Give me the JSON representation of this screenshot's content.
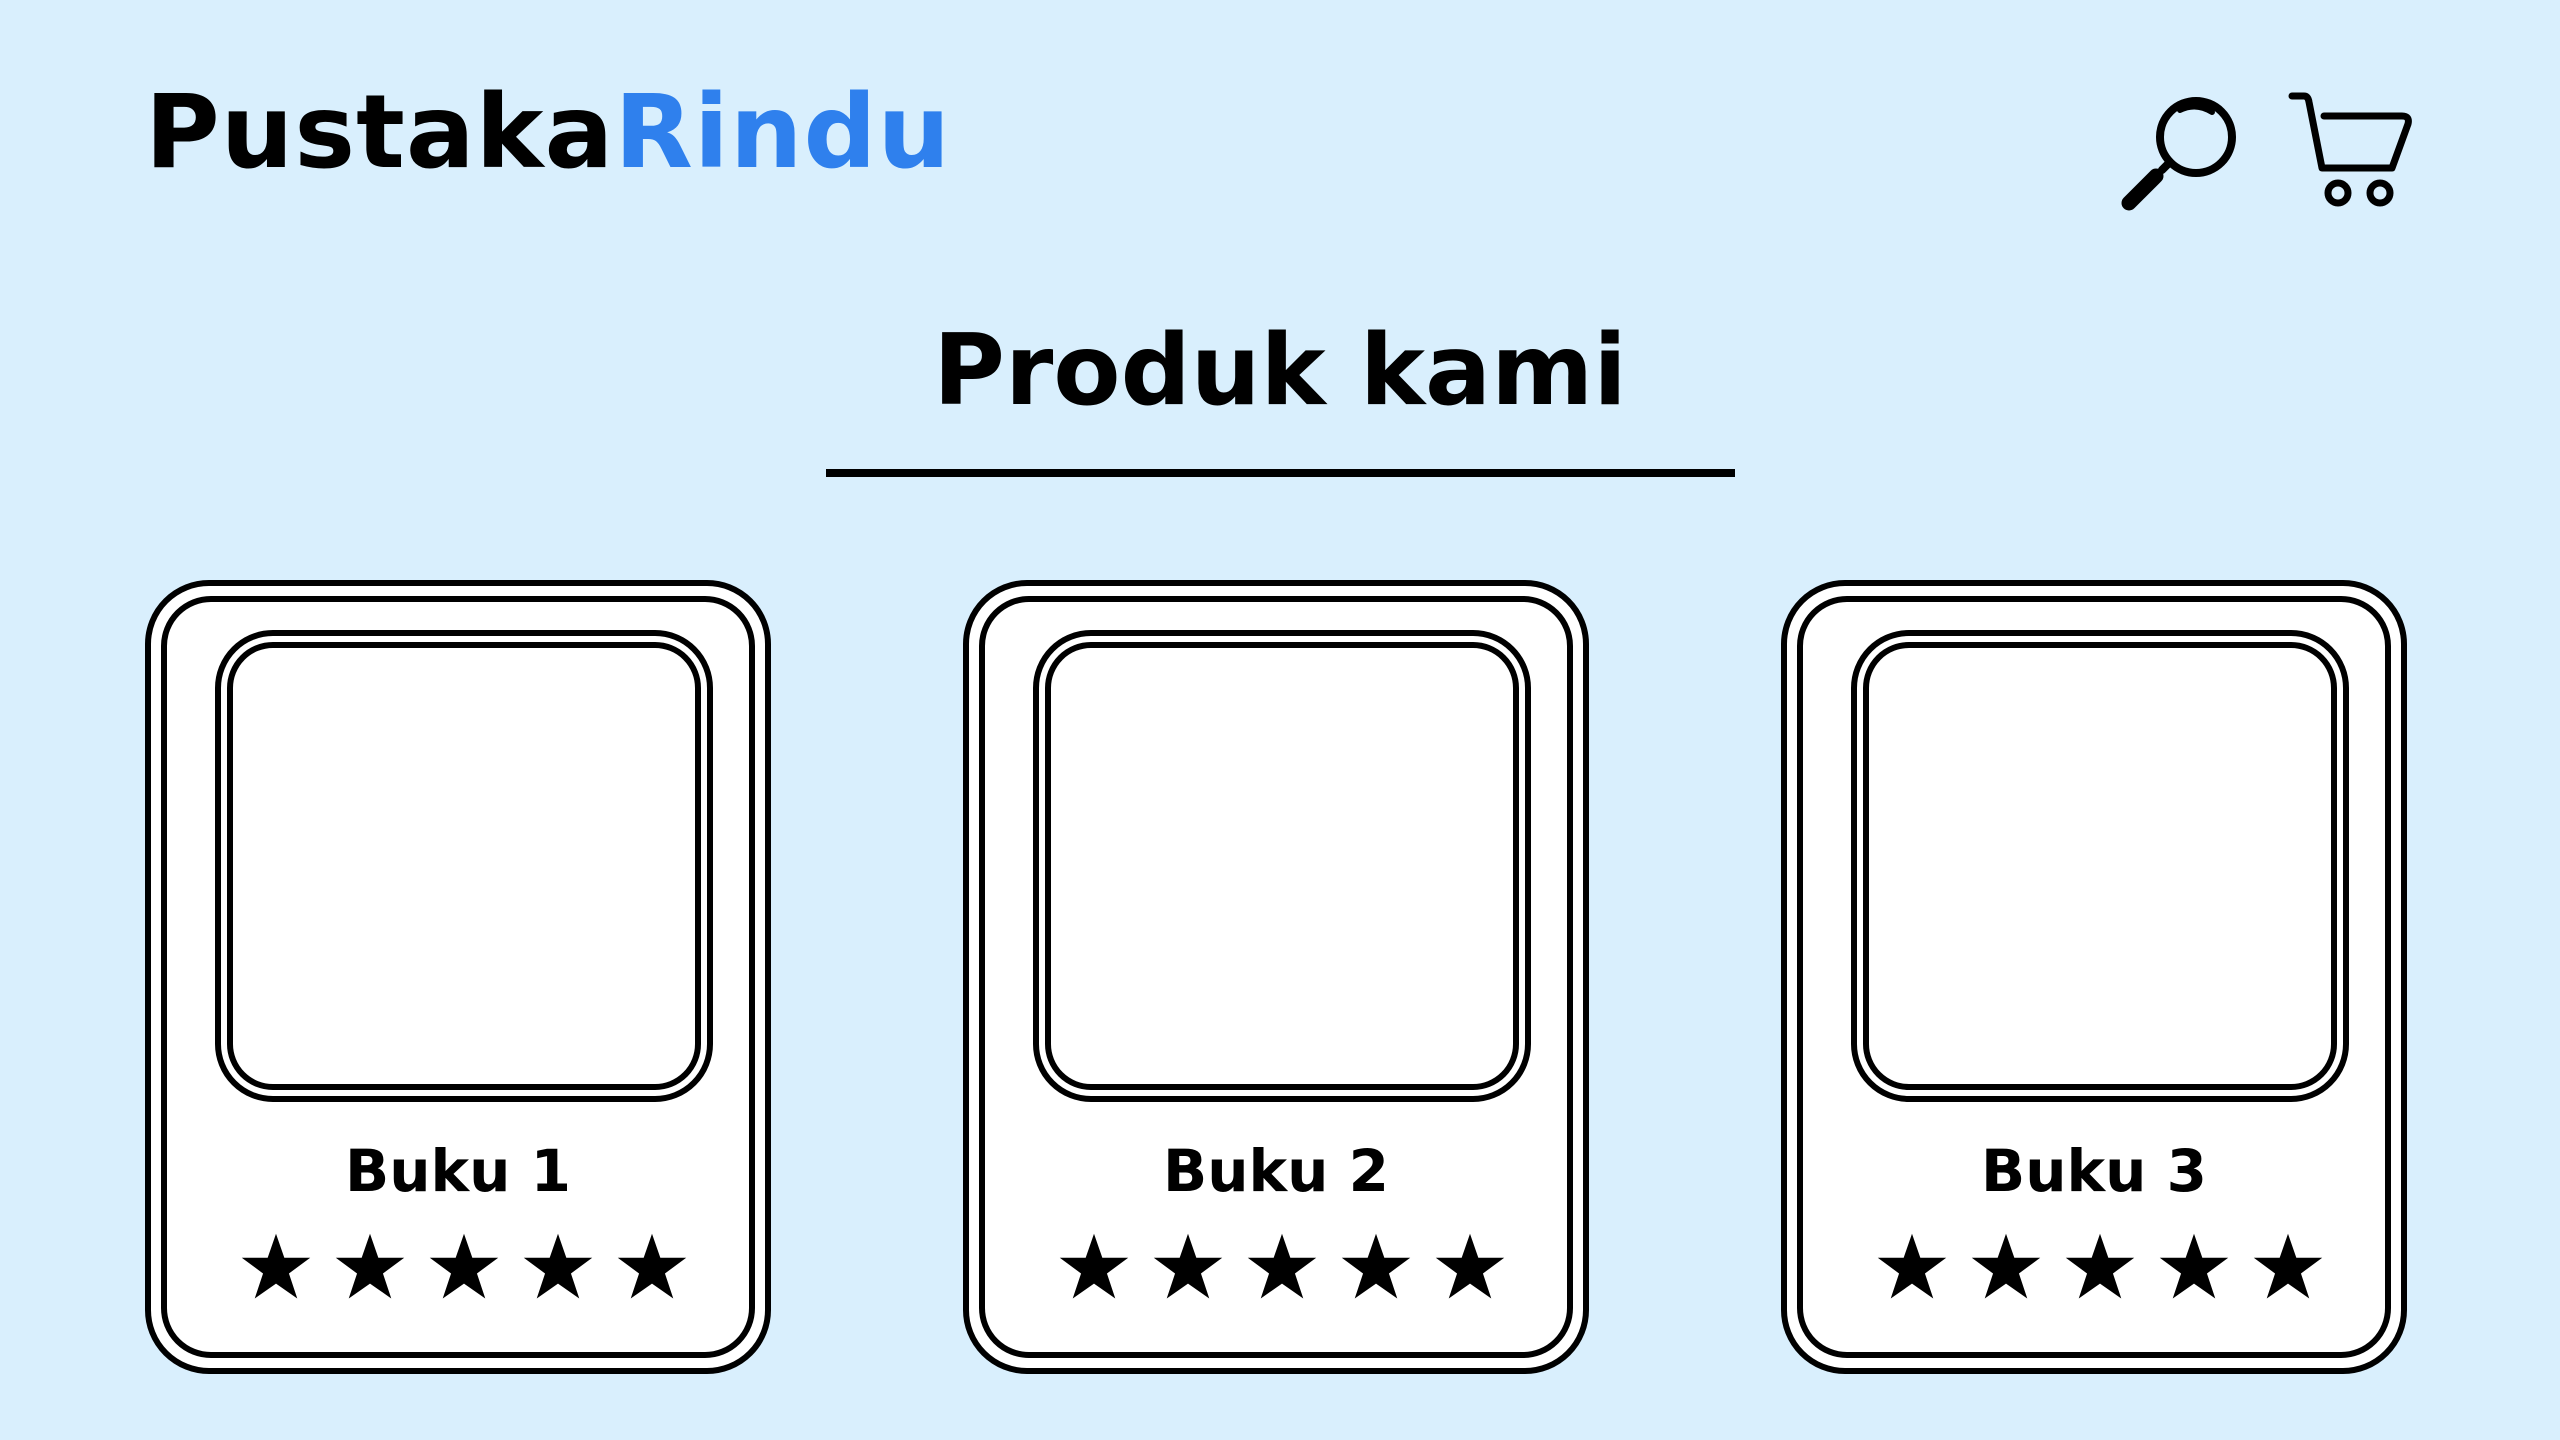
{
  "brand": {
    "part_a": "Pustaka",
    "part_b": "Rindu",
    "accent_color": "#2f80ed"
  },
  "header": {
    "icons": [
      "search-icon",
      "cart-icon"
    ]
  },
  "section": {
    "title": "Produk kami"
  },
  "products": [
    {
      "title": "Buku 1",
      "rating": 5,
      "rating_max": 5
    },
    {
      "title": "Buku 2",
      "rating": 5,
      "rating_max": 5
    },
    {
      "title": "Buku 3",
      "rating": 5,
      "rating_max": 5
    }
  ],
  "colors": {
    "background": "#d9effd",
    "card": "#ffffff",
    "ink": "#000000"
  }
}
